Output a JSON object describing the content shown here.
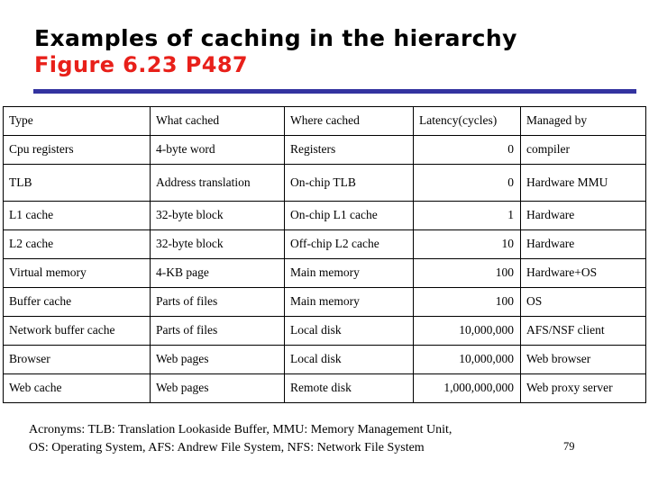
{
  "slide": {
    "title": "Examples of caching in the hierarchy",
    "subtitle": "Figure 6.23  P487",
    "title_color": "#000000",
    "subtitle_color": "#e8201a",
    "rule_color": "#3333a0",
    "page_number": "79"
  },
  "table": {
    "headers": {
      "type": "Type",
      "what_cached": "What cached",
      "where_cached": "Where cached",
      "latency": "Latency(cycles)",
      "managed_by": "Managed by"
    },
    "rows": [
      {
        "type": "Cpu registers",
        "what_cached": "4-byte word",
        "where_cached": "Registers",
        "latency": "0",
        "managed_by": "compiler"
      },
      {
        "type": "TLB",
        "what_cached": "Address translation",
        "where_cached": "On-chip TLB",
        "latency": "0",
        "managed_by": "Hardware MMU"
      },
      {
        "type": "L1 cache",
        "what_cached": "32-byte block",
        "where_cached": "On-chip L1 cache",
        "latency": "1",
        "managed_by": "Hardware"
      },
      {
        "type": "L2 cache",
        "what_cached": "32-byte block",
        "where_cached": "Off-chip L2 cache",
        "latency": "10",
        "managed_by": "Hardware"
      },
      {
        "type": "Virtual memory",
        "what_cached": "4-KB page",
        "where_cached": "Main memory",
        "latency": "100",
        "managed_by": "Hardware+OS"
      },
      {
        "type": "Buffer cache",
        "what_cached": "Parts of files",
        "where_cached": "Main memory",
        "latency": "100",
        "managed_by": "OS"
      },
      {
        "type": "Network buffer cache",
        "what_cached": "Parts of files",
        "where_cached": "Local disk",
        "latency": "10,000,000",
        "managed_by": "AFS/NSF client"
      },
      {
        "type": "Browser",
        "what_cached": "Web pages",
        "where_cached": "Local disk",
        "latency": "10,000,000",
        "managed_by": "Web browser"
      },
      {
        "type": "Web cache",
        "what_cached": "Web pages",
        "where_cached": "Remote disk",
        "latency": "1,000,000,000",
        "managed_by": "Web proxy server"
      }
    ]
  },
  "footer": {
    "line1": "Acronyms: TLB: Translation Lookaside Buffer, MMU: Memory Management Unit,",
    "line2": "OS: Operating System, AFS: Andrew File System, NFS: Network File System"
  }
}
